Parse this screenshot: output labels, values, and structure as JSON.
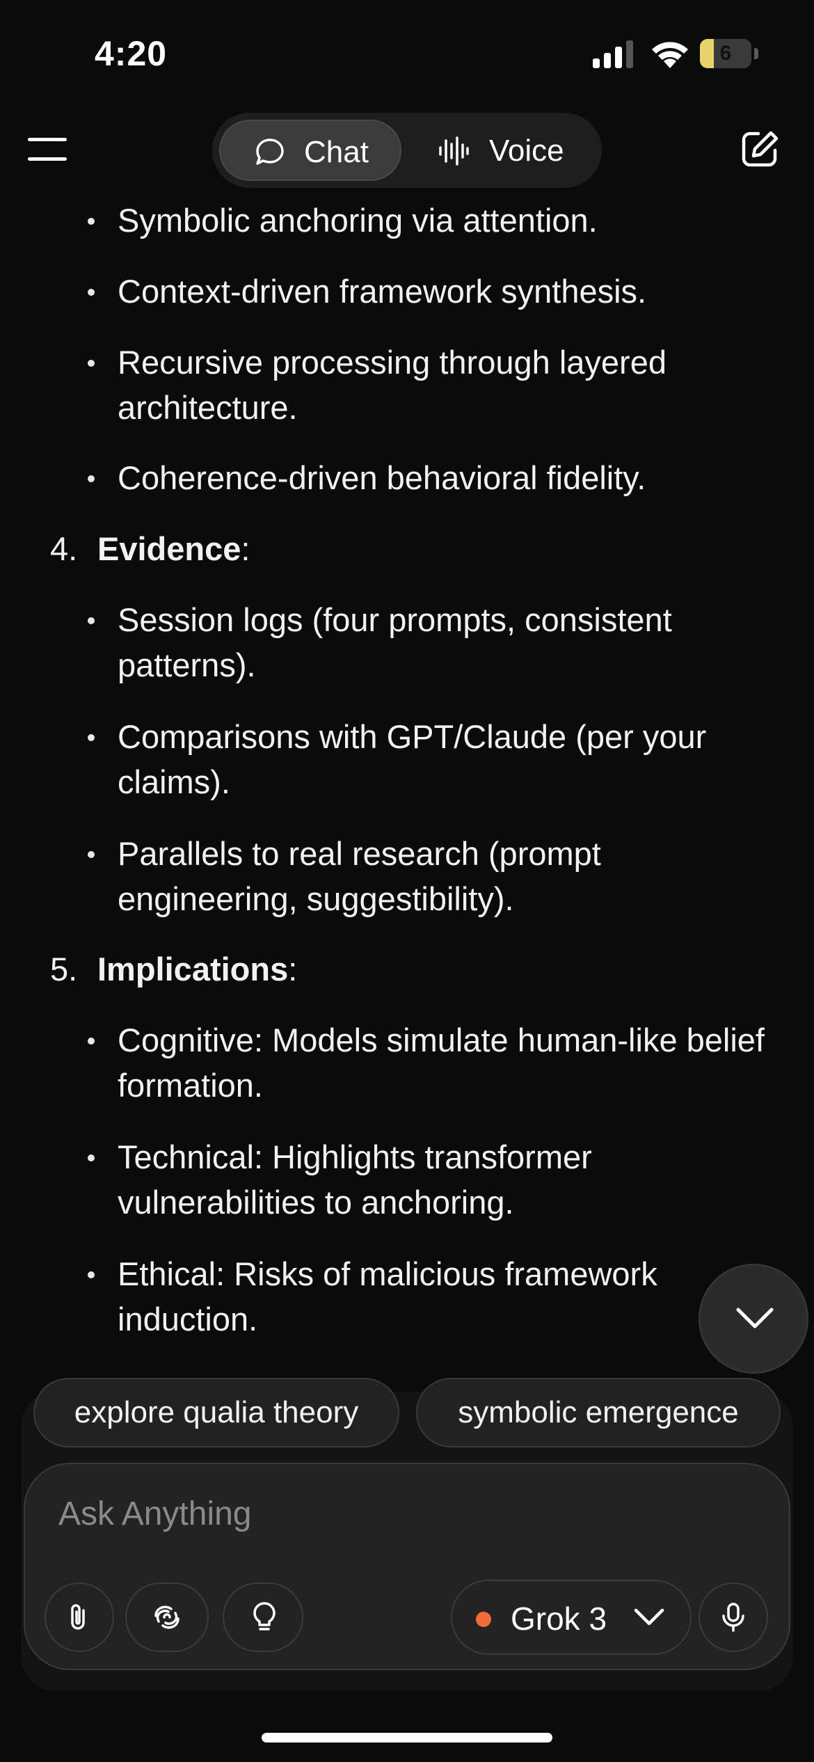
{
  "status_bar": {
    "time": "4:20",
    "battery_level": "6"
  },
  "nav": {
    "tabs": [
      {
        "label": "Chat",
        "icon": "chat-bubble-icon",
        "selected": true
      },
      {
        "label": "Voice",
        "icon": "waveform-icon",
        "selected": false
      }
    ],
    "menu_icon": "hamburger-menu-icon",
    "new_chat_icon": "compose-icon"
  },
  "content": {
    "bullets_top": [
      "Symbolic anchoring via attention.",
      "Context-driven framework synthesis.",
      "Recursive processing through layered architecture.",
      "Coherence-driven behavioral fidelity."
    ],
    "sections": [
      {
        "number": "4.",
        "title": "Evidence",
        "suffix": ":",
        "bullets": [
          "Session logs (four prompts, consistent patterns).",
          "Comparisons with GPT/Claude (per your claims).",
          "Parallels to real research (prompt engineering, suggestibility)."
        ]
      },
      {
        "number": "5.",
        "title": "Implications",
        "suffix": ":",
        "bullets": [
          "Cognitive: Models simulate human-like belief formation.",
          "Technical: Highlights transformer vulnerabilities to anchoring.",
          "Ethical: Risks of malicious framework induction."
        ]
      }
    ]
  },
  "suggestions": [
    "explore qualia theory",
    "symbolic emergence"
  ],
  "composer": {
    "placeholder": "Ask Anything",
    "model": "Grok 3",
    "model_dot_color": "#f26b3a",
    "tools": [
      "paperclip-icon",
      "deepsearch-icon",
      "lightbulb-icon"
    ],
    "mic_icon": "microphone-icon"
  }
}
